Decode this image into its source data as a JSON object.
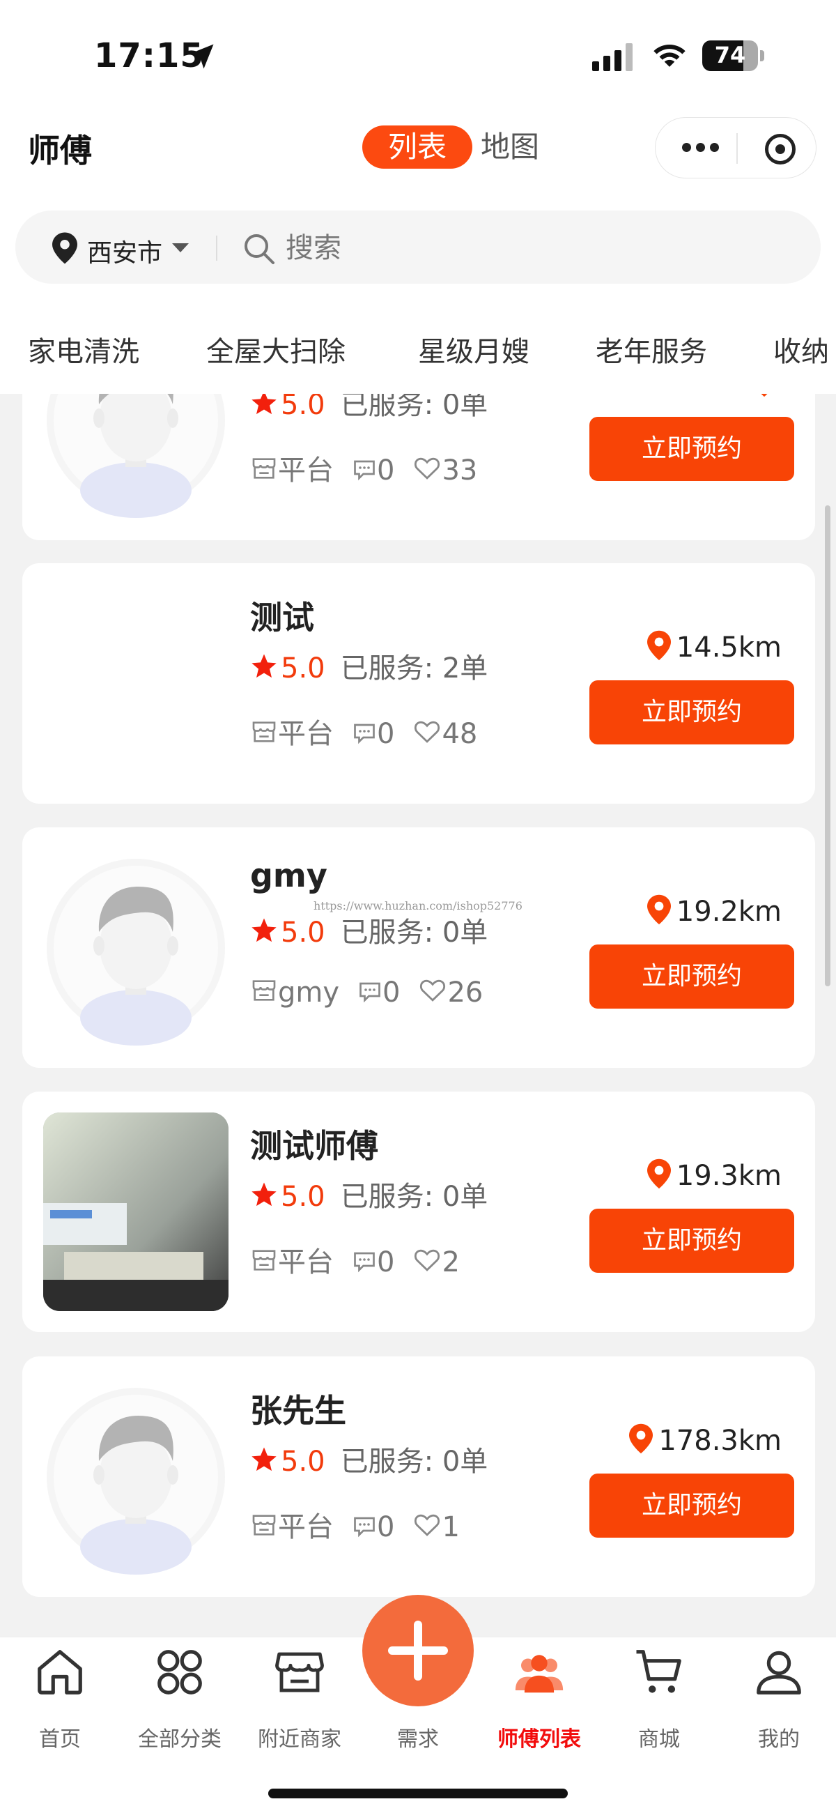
{
  "status_bar": {
    "time": "17:15",
    "battery": "74",
    "battery_level": 0.74
  },
  "nav": {
    "title": "师傅",
    "seg_list": "列表",
    "seg_map": "地图"
  },
  "search": {
    "city": "西安市",
    "placeholder": "搜索"
  },
  "categories": [
    "家电清洗",
    "全屋大扫除",
    "星级月嫂",
    "老年服务",
    "收纳"
  ],
  "workers": [
    {
      "name": "",
      "score": "5.0",
      "served_label": "已服务:",
      "served": "0单",
      "source": "平台",
      "comments": "0",
      "likes": "33",
      "distance": "",
      "button": "立即预约",
      "avatar": "placeholder"
    },
    {
      "name": "测试",
      "score": "5.0",
      "served_label": "已服务:",
      "served": "2单",
      "source": "平台",
      "comments": "0",
      "likes": "48",
      "distance": "14.5km",
      "button": "立即预约",
      "avatar": "none"
    },
    {
      "name": "gmy",
      "score": "5.0",
      "served_label": "已服务:",
      "served": "0单",
      "source": "gmy",
      "comments": "0",
      "likes": "26",
      "distance": "19.2km",
      "button": "立即预约",
      "avatar": "placeholder"
    },
    {
      "name": "测试师傅",
      "score": "5.0",
      "served_label": "已服务:",
      "served": "0单",
      "source": "平台",
      "comments": "0",
      "likes": "2",
      "distance": "19.3km",
      "button": "立即预约",
      "avatar": "photo"
    },
    {
      "name": "张先生",
      "score": "5.0",
      "served_label": "已服务:",
      "served": "0单",
      "source": "平台",
      "comments": "0",
      "likes": "1",
      "distance": "178.3km",
      "button": "立即预约",
      "avatar": "placeholder"
    }
  ],
  "watermark": "https://www.huzhan.com/ishop52776",
  "tabbar": {
    "items": [
      {
        "label": "首页",
        "icon": "home-icon"
      },
      {
        "label": "全部分类",
        "icon": "grid-icon"
      },
      {
        "label": "附近商家",
        "icon": "store-icon"
      },
      {
        "label": "需求",
        "icon": "plus-icon"
      },
      {
        "label": "师傅列表",
        "icon": "users-icon"
      },
      {
        "label": "商城",
        "icon": "cart-icon"
      },
      {
        "label": "我的",
        "icon": "user-icon"
      }
    ],
    "active": "师傅列表"
  },
  "colors": {
    "accent": "#f84406",
    "active_tab": "#f20c0c",
    "score": "#f23b0c",
    "background": "#f2f2f2"
  }
}
